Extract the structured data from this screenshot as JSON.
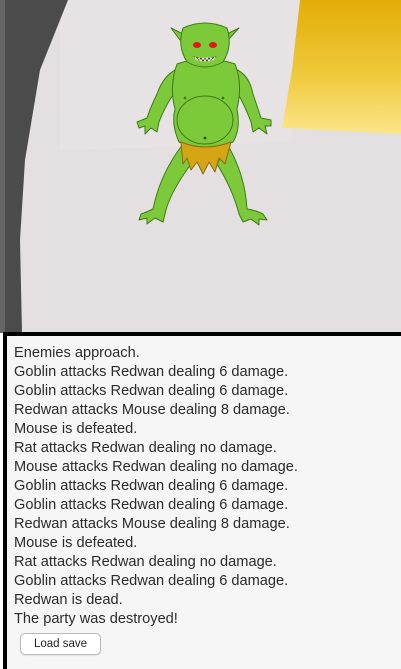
{
  "scene": {
    "enemy_name": "Goblin",
    "colors": {
      "cave_wall": "#4b4b4b",
      "cave_floor": "#e4e0e1",
      "light_opening": "#e6b70c",
      "goblin_skin": "#7cc93a",
      "goblin_loincloth": "#d4a514",
      "goblin_eyes": "#e01818"
    }
  },
  "log": {
    "lines": [
      "Enemies approach.",
      "Goblin attacks Redwan dealing 6 damage.",
      "Goblin attacks Redwan dealing 6 damage.",
      "Redwan attacks Mouse dealing 8 damage.",
      "Mouse is defeated.",
      "Rat attacks Redwan dealing no damage.",
      "Mouse attacks Redwan dealing no damage.",
      "Goblin attacks Redwan dealing 6 damage.",
      "Goblin attacks Redwan dealing 6 damage.",
      "Redwan attacks Mouse dealing 8 damage.",
      "Mouse is defeated.",
      "Rat attacks Redwan dealing no damage.",
      "Goblin attacks Redwan dealing 6 damage.",
      "Redwan is dead.",
      "The party was destroyed!"
    ]
  },
  "controls": {
    "load_save_label": "Load save"
  }
}
